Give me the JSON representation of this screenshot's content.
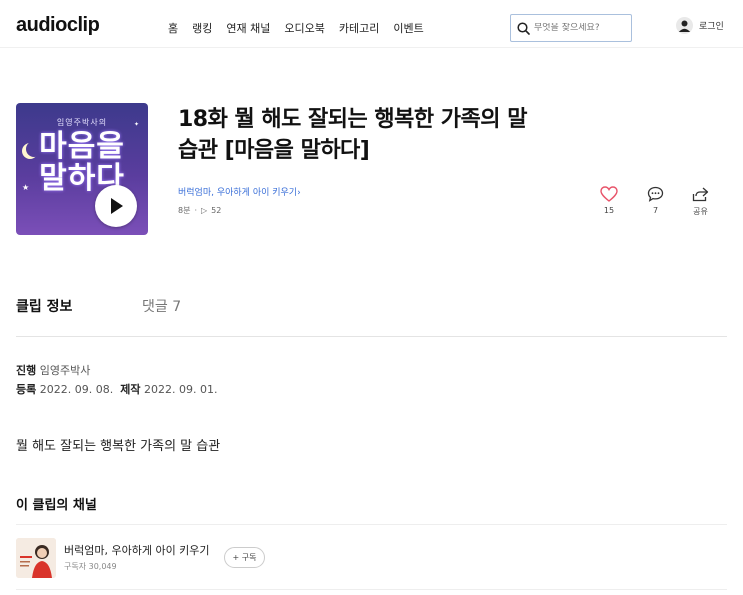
{
  "header": {
    "logo": "audioclip",
    "nav": [
      "홈",
      "랭킹",
      "연재 채널",
      "오디오북",
      "카테고리",
      "이벤트"
    ],
    "search_placeholder": "무엇을 찾으세요?",
    "login": "로그인"
  },
  "cover": {
    "subtitle": "임영주박사의",
    "title_line1": "마음을",
    "title_line2": "말하다"
  },
  "episode": {
    "title_line1": "18화 뭘 해도 잘되는 행복한 가족의 말",
    "title_line2": "습관 [마음을 말하다]",
    "channel": "버럭엄마, 우아하게 아이 키우기",
    "duration": "8분",
    "plays": "52"
  },
  "actions": {
    "likes": "15",
    "comments": "7",
    "share": "공유"
  },
  "tabs": {
    "info": "클립 정보",
    "comments": "댓글 7"
  },
  "info": {
    "host_label": "진행",
    "host": "임영주박사",
    "reg_label": "등록",
    "reg_date": "2022. 09. 08.",
    "prod_label": "제작",
    "prod_date": "2022. 09. 01."
  },
  "description": "뭘 해도 잘되는 행복한 가족의 말 습관",
  "channel_section": {
    "title": "이 클립의 채널",
    "name": "버럭엄마, 우아하게 아이 키우기",
    "subscribers": "구독자 30,049",
    "subscribe_label": "+ 구독"
  },
  "colors": {
    "accent_link": "#3a6fd8",
    "like_heart": "#e8546a",
    "cover_purple": "#5a3d9e"
  }
}
